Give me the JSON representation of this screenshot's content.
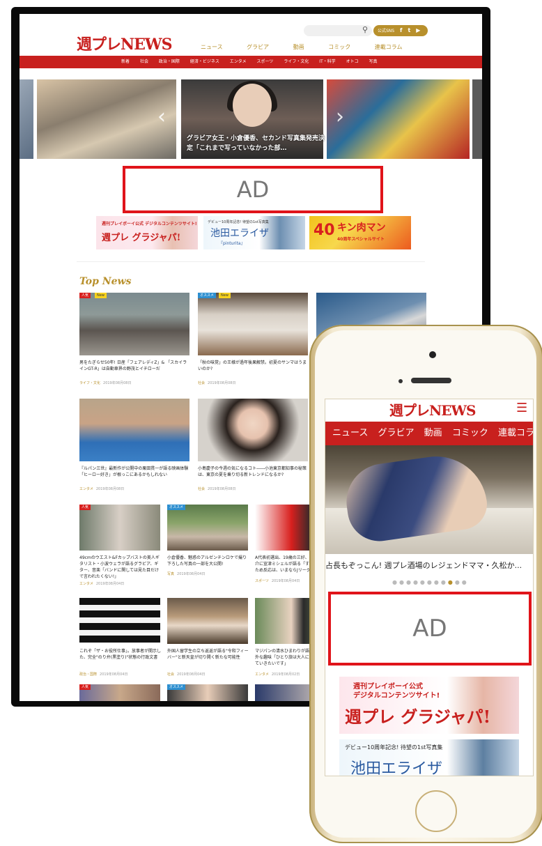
{
  "desktop": {
    "logo": "週プレNEWS",
    "sns_label": "公式SNS",
    "sns_icons": [
      "f",
      "t",
      "▶"
    ],
    "nav": [
      "ニュース",
      "グラビア",
      "動画",
      "コミック",
      "連載コラム"
    ],
    "categories": [
      "新着",
      "社会",
      "政治・国際",
      "経済・ビジネス",
      "エンタメ",
      "スポーツ",
      "ライフ・文化",
      "IT・科学",
      "オトコ",
      "写真"
    ],
    "slider_caption": "グラビア女王・小倉優香、セカンド写真集発売決定「これまで写っていなかった部…",
    "ad_label": "AD",
    "banners": {
      "b1_text": "週刊プレイボーイ公式 デジタルコンテンツサイト!",
      "b1_logo": "週プレ グラジャパ!",
      "b2_text": "デビュー10周年記念! 待望の1st写真集",
      "b2_logo": "池田エライザ",
      "b2_sub": "『pinturita』",
      "b3_num": "40",
      "b3_logo": "キン肉マン",
      "b3_sub": "40周年スペシャルサイト"
    },
    "top_news_heading": "Top News",
    "cards": [
      {
        "badges": [
          "人気",
          "New"
        ],
        "title": "男をたぎらせ50年! 日産「フェアレディZ」& 「スカイラインGT-R」は自動車界の野茂とイチローだ",
        "category": "ライフ・文化",
        "date": "2019年08月08日"
      },
      {
        "badges": [
          "オススメ",
          "New"
        ],
        "title": "「秋の味覚」の王様が過年後果解禁。初夏のサンマはうまいのか?",
        "category": "社会",
        "date": "2019年08月08日"
      },
      {
        "badges": [],
        "title": "",
        "category": "",
        "date": ""
      },
      {
        "badges": [],
        "title": "『ルパン三世』最新作が公開中の栗田貫一が語る映画体験「ヒーロー好き」が根っこにあるかもしれない",
        "category": "エンタメ",
        "date": "2019年08月08日"
      },
      {
        "badges": [],
        "title": "小島慶子の今週の気になるコト――小池東京都知事の秘策は、東京の夏を乗り切る新トレンドになるか?",
        "category": "社会",
        "date": "2019年08月08日"
      },
      {
        "badges": [
          "人気"
        ],
        "title": "49cmのウエスト&Fカップバストの美人ギタリスト・小波ウェラが語るグラビア、ギター、音楽「バンドに関しては見た目だけで言われたくない!」",
        "category": "エンタメ",
        "date": "2019年08月04日"
      },
      {
        "badges": [
          "オススメ"
        ],
        "title": "小倉優香、魅惑のアルゼンチンロケで撮り下ろした写真の一部を大公開!",
        "category": "写真",
        "date": "2019年08月04日"
      },
      {
        "badges": [],
        "title": "A代表初選出、19歳の三好、神奈川出身、介に宣津ミシェルが語る「すぐ代表に戻るため反応は、いまならJリーグ」",
        "category": "スポーツ",
        "date": "2019年08月04日"
      },
      {
        "badges": [],
        "title": "これぞ「ザ・お役所仕事」。放事者が開示した、完全\"のり弁(黒塗り)\"状態の行政文書",
        "category": "政治・国際",
        "date": "2019年08月04日"
      },
      {
        "badges": [],
        "title": "外国人留学生の立ち返返が語る\"令和フィーバー\"と新天皇が切り開く新たな可能性",
        "category": "社会",
        "date": "2019年08月04日"
      },
      {
        "badges": [],
        "title": "マジパンの清水ひまわりが語るギタリスト外な趣味「ひとり旅は大人になっても続けていきたいです」",
        "category": "エンタメ",
        "date": "2019年08月02日"
      },
      {
        "badges": [
          "人気"
        ],
        "title": "",
        "category": "",
        "date": ""
      },
      {
        "badges": [
          "オススメ"
        ],
        "title": "",
        "category": "",
        "date": ""
      },
      {
        "badges": [],
        "title": "",
        "category": "",
        "date": ""
      }
    ]
  },
  "mobile": {
    "logo": "週プレNEWS",
    "nav": [
      "ニュース",
      "グラビア",
      "動画",
      "コミック",
      "連載コラム"
    ],
    "caption": "占長もぞっこん! 週プレ酒場のレジェンドママ・久松か...",
    "ad_label": "AD",
    "banner1_text": "週刊プレイボーイ公式\nデジタルコンテンツサイト!",
    "banner1_logo": "週プレ グラジャパ!",
    "banner2_text": "デビュー10周年記念! 待望の1st写真集",
    "banner2_logo": "池田エライザ"
  }
}
